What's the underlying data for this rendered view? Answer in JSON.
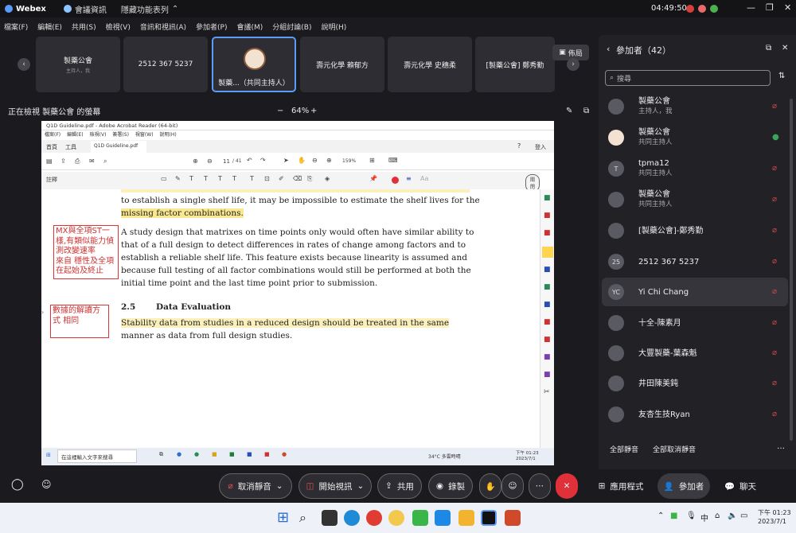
{
  "app": {
    "name": "Webex",
    "meeting_info": "會議資訊",
    "hidden_features": "隱藏功能表列",
    "clock": "04:49:50"
  },
  "menu": [
    "檔案(F)",
    "編輯(E)",
    "共用(S)",
    "檢視(V)",
    "音訊和視訊(A)",
    "參加者(P)",
    "會議(M)",
    "分組討論(B)",
    "說明(H)"
  ],
  "strip": {
    "tiles": [
      {
        "name": "製藥公會",
        "sub": "主持人，我"
      },
      {
        "name": "2512 367 5237",
        "sub": ""
      },
      {
        "name": "製藥...（共同主持人）",
        "sub": ""
      },
      {
        "name": "壽元化學 賴郁方",
        "sub": ""
      },
      {
        "name": "壽元化學 史穗柔",
        "sub": ""
      },
      {
        "name": "[製藥公會] 鄭秀勤",
        "sub": ""
      }
    ],
    "layout_label": "佈局"
  },
  "share": {
    "label": "正在檢視 製藥公會 的螢幕",
    "zoom": "64%",
    "minus": "−",
    "plus": "+"
  },
  "acrobat": {
    "title": "Q1D Guideline.pdf - Adobe Acrobat Reader (64-bit)",
    "menus": [
      "檔案(F)",
      "編輯(E)",
      "檢視(V)",
      "簽署(S)",
      "視窗(W)",
      "說明(H)"
    ],
    "tabs": [
      "首頁",
      "工具",
      "Q1D Guideline.pdf"
    ],
    "login": "登入",
    "page": "11",
    "pages": "/ 41",
    "zoom": "159%",
    "annot_label": "註釋",
    "close_label": "關閉"
  },
  "doc": {
    "line0": "to establish a single shelf life, it may be impossible to estimate the shelf lives for the",
    "line1": "missing factor combinations.",
    "para": [
      "A study design that matrixes on time points only would often have similar ability to",
      "that of a full design to detect differences in rates of change among factors and to",
      "establish a reliable shelf life. This feature exists because linearity is assumed and",
      "because full testing of all factor combinations would still be performed at both the",
      "initial time point and the last time point prior to submission."
    ],
    "section_num": "2.5",
    "section_title": "Data Evaluation",
    "para2": [
      "Stability data from studies in a reduced design should be treated in the same",
      "manner as data from full design studies."
    ],
    "note1": [
      "MX與全項ST一",
      "樣,有類似能力偵",
      "測改變速率",
      "來自 穩性及全項",
      "在起始及終止"
    ],
    "note2": [
      "數據的解讀方",
      "式 相同"
    ]
  },
  "inner_taskbar": {
    "search": "在這裡輸入文字來搜尋",
    "weather": "34°C 多雲時晴",
    "time": "下午 01:23",
    "date": "2023/7/1"
  },
  "panel": {
    "title": "參加者（42）",
    "search_placeholder": "搜尋",
    "mute_all": "全部靜音",
    "unmute_all": "全部取消靜音",
    "participants": [
      {
        "name": "製藥公會",
        "role": "主持人，我",
        "avatar": ""
      },
      {
        "name": "製藥公會",
        "role": "共同主持人",
        "avatar": ""
      },
      {
        "name": "tpma12",
        "role": "共同主持人",
        "avatar": "T"
      },
      {
        "name": "製藥公會",
        "role": "共同主持人",
        "avatar": ""
      },
      {
        "name": "[製藥公會]-鄭秀勤",
        "role": "",
        "avatar": ""
      },
      {
        "name": "2512 367 5237",
        "role": "",
        "avatar": "25"
      },
      {
        "name": "Yi Chi Chang",
        "role": "",
        "avatar": "YC"
      },
      {
        "name": "十全-陳素月",
        "role": "",
        "avatar": ""
      },
      {
        "name": "大豐製藥-葉森魁",
        "role": "",
        "avatar": ""
      },
      {
        "name": "井田陳美鈍",
        "role": "",
        "avatar": ""
      },
      {
        "name": "友杏生技Ryan",
        "role": "",
        "avatar": ""
      }
    ]
  },
  "controls": {
    "mute": "取消靜音",
    "video": "開始視訊",
    "share": "共用",
    "record": "錄製",
    "apps": "應用程式",
    "participants": "參加者",
    "chat": "聊天"
  },
  "taskbar": {
    "lang": "中",
    "time": "下午 01:23",
    "date": "2023/7/1"
  },
  "colors": {
    "accent": "#5a9cf8",
    "end": "#e0303a",
    "highlight": "#f9e88f"
  }
}
